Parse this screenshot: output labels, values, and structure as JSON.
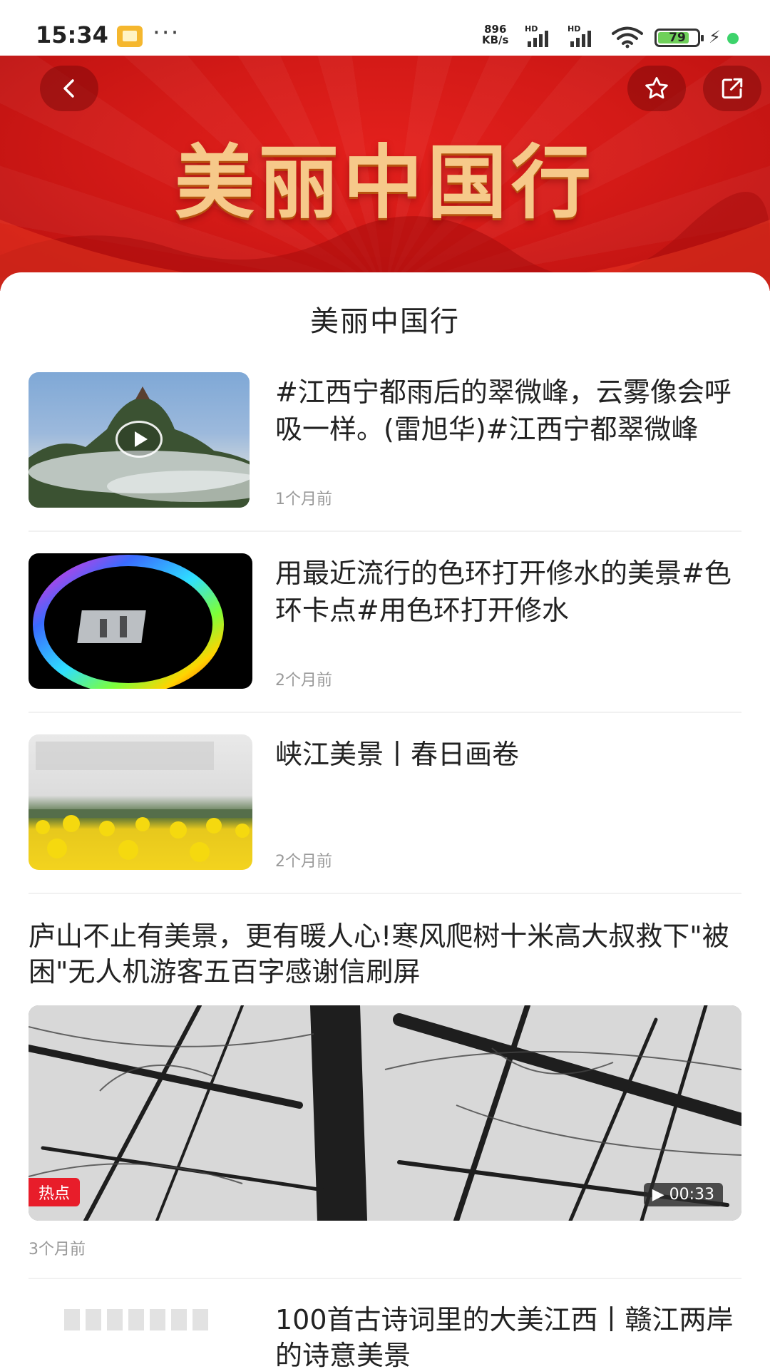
{
  "status_bar": {
    "time": "15:34",
    "more": "···",
    "speed_value": "896",
    "speed_unit": "KB/s",
    "sim1": "HD",
    "sim2": "HD",
    "battery_level": 79,
    "battery_text": "79"
  },
  "banner": {
    "title": "美丽中国行",
    "back_icon": "chevron-left-icon",
    "favorite_icon": "star-icon",
    "share_icon": "share-icon"
  },
  "sheet": {
    "title": "美丽中国行"
  },
  "items": [
    {
      "title": "#江西宁都雨后的翠微峰，云雾像会呼吸一样。(雷旭华)#江西宁都翠微峰",
      "time": "1个月前"
    },
    {
      "title": "用最近流行的色环打开修水的美景#色环卡点#用色环打开修水",
      "time": "2个月前"
    },
    {
      "title": "峡江美景丨春日画卷",
      "time": "2个月前"
    }
  ],
  "featured": {
    "title": "庐山不止有美景，更有暖人心!寒风爬树十米高大叔救下\"被困\"无人机游客五百字感谢信刷屏",
    "badge": "热点",
    "duration": "▶ 00:33",
    "time": "3个月前"
  },
  "last_item": {
    "title": "100首古诗词里的大美江西丨赣江两岸的诗意美景"
  },
  "colors": {
    "banner_red": "#d41a17",
    "banner_gold": "#f6c98a",
    "hot_badge": "#e81d2a",
    "muted_text": "#999999"
  }
}
